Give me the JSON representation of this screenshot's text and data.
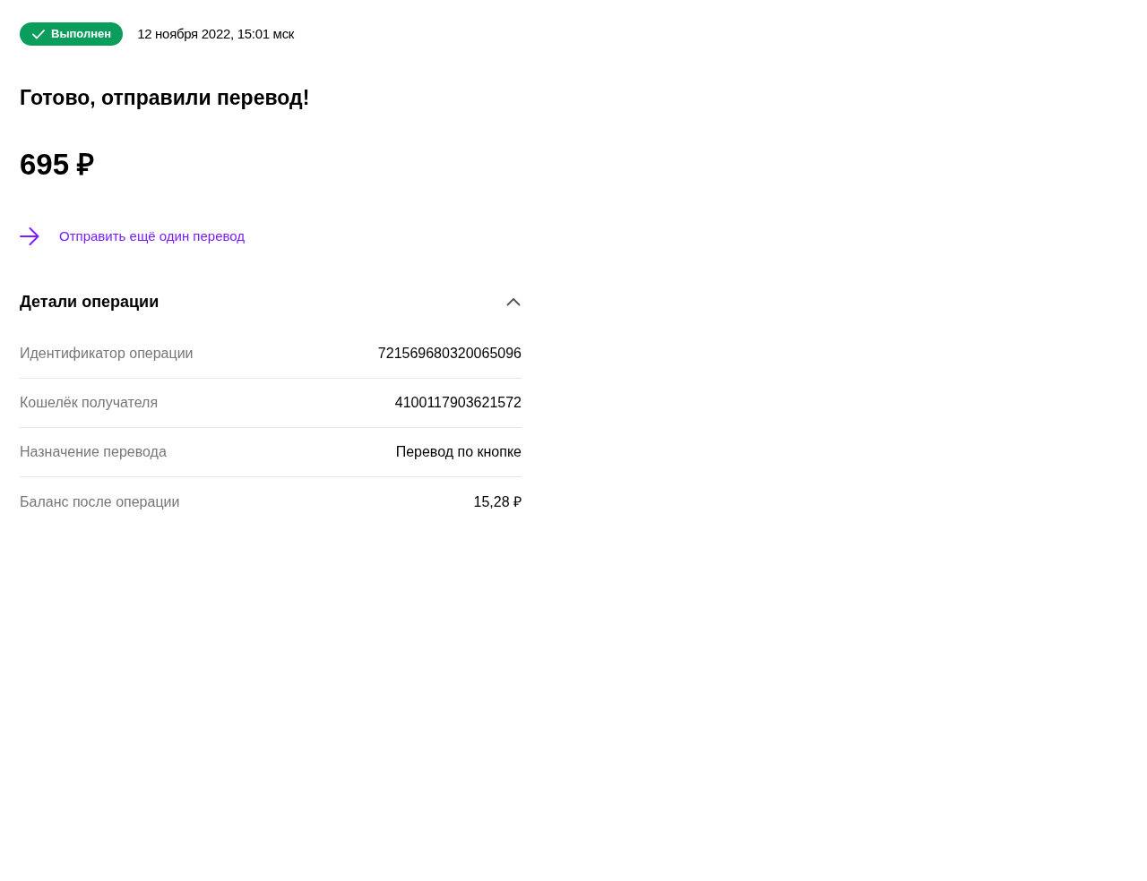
{
  "status": {
    "kind": "success",
    "label": "Выполнен"
  },
  "date": "12 ноября 2022, 15:01 мск",
  "heading": "Готово, отправили перевод!",
  "amount": "695 ₽",
  "action_link": {
    "label": "Отправить ещё один перевод"
  },
  "details": {
    "title": "Детали операции",
    "expanded": true,
    "rows": [
      {
        "label": "Идентификатор операции",
        "value": "721569680320065096"
      },
      {
        "label": "Кошелёк получателя",
        "value": "4100117903621572"
      },
      {
        "label": "Назначение перевода",
        "value": "Перевод по кнопке"
      },
      {
        "label": "Баланс после операции",
        "value": "15,28 ₽"
      }
    ]
  }
}
